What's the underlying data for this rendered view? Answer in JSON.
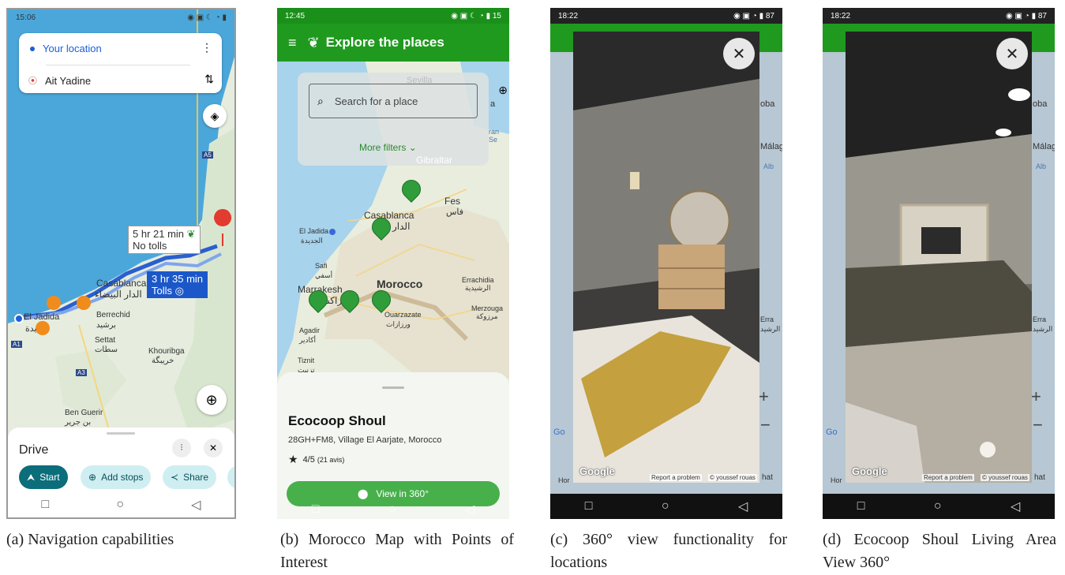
{
  "panel_a": {
    "status_time": "15:06",
    "origin": "Your location",
    "destination": "Ait Yadine",
    "route_primary": {
      "time": "5 hr 21 min",
      "note": "No tolls"
    },
    "route_alt": {
      "time": "3 hr 35 min",
      "note": "Tolls"
    },
    "map_labels": {
      "casablanca": "Casablanca",
      "casablanca_ar": "الدار البيضاء",
      "el_jadida": "El Jadida",
      "el_jadida_ar": "يدة",
      "berrechid": "Berrechid",
      "berrechid_ar": "برشيد",
      "settat": "Settat",
      "settat_ar": "سطات",
      "khouribga": "Khouribga",
      "khouribga_ar": "خريبگة",
      "ben_guerir": "Ben Guerir",
      "ben_guerir_ar": "بن جرير",
      "a5": "A5",
      "a1": "A1",
      "a3": "A3"
    },
    "sheet_title": "Drive",
    "buttons": {
      "start": "Start",
      "add_stops": "Add stops",
      "share": "Share"
    },
    "caption": "(a) Navigation capabilities"
  },
  "panel_b": {
    "status_time": "12:45",
    "battery": "15",
    "app_title": "Explore the places",
    "search_placeholder": "Search for a place",
    "more_filters": "More filters",
    "map_labels": {
      "gibraltar": "Gibraltar",
      "sevilla": "Sevilla",
      "fes": "Fes",
      "fes_ar": "فاس",
      "casablanca": "Casablanca",
      "casablanca_ar": "الدار",
      "el_jadida": "El Jadida",
      "el_jadida_ar": "الجديدة",
      "safi": "Safi",
      "safi_ar": "أسفي",
      "marrakesh": "Marrakesh",
      "marrakesh_ar": "راكش",
      "morocco": "Morocco",
      "errachidia": "Errachidia",
      "errachidia_ar": "الرشيدية",
      "merzouga": "Merzouga",
      "merzouga_ar": "مرزوكة",
      "ouarzazate": "Ouarzazate",
      "ouarzazate_ar": "ورزازات",
      "agadir": "Agadir",
      "agadir_ar": "أكادير",
      "tiznit": "Tiznit",
      "tiznit_ar": "تزنيت",
      "a_label": "a",
      "sea": "ran Se"
    },
    "place": {
      "name": "Ecocoop Shoul",
      "address": "28GH+FM8, Village El Aarjate, Morocco",
      "rating": "4/5",
      "reviews": "(21 avis)"
    },
    "view360": "View in 360°",
    "caption": "(b) Morocco Map with Points of Interest"
  },
  "panel_c": {
    "status_time": "18:22",
    "battery": "87",
    "google": "Google",
    "report": "Report a problem",
    "credit": "© youssef rouas",
    "credit_tail": "hat",
    "bg_labels": {
      "oba": "oba",
      "malaga": "Málag",
      "alb": "Alb",
      "erra": "Erra",
      "rrach": "الرشيد",
      "ho": "Hor",
      "go": "Go"
    },
    "caption": "(c) 360° view functionality for locations"
  },
  "panel_d": {
    "status_time": "18:22",
    "battery": "87",
    "google": "Google",
    "report": "Report a problem",
    "credit": "© youssef rouas",
    "credit_tail": "hat",
    "bg_labels": {
      "oba": "oba",
      "malaga": "Málag",
      "alb": "Alb",
      "erra": "Erra",
      "rrach": "الرشيد",
      "ho": "Hor",
      "go": "Go"
    },
    "caption": "(d) Ecocoop Shoul Living Area View 360°"
  },
  "colors": {
    "map_land": "#e8eee2",
    "map_sea": "#4aa6d9",
    "route": "#2763d8",
    "green_app": "#1f9a1f",
    "teal": "#0b6e7a",
    "marker_green": "#2f9e3a"
  }
}
